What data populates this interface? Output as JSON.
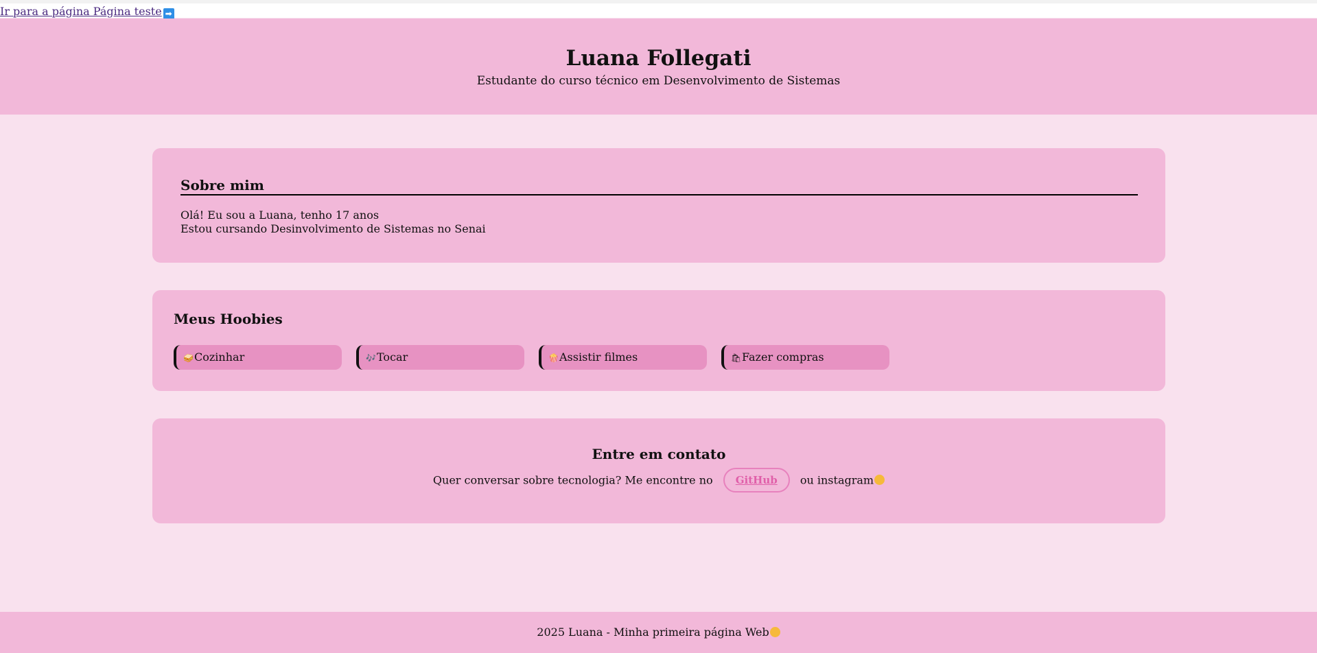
{
  "topbar": {
    "link_text": "Ir para a página Página teste",
    "link_icon": "arrow-right-icon"
  },
  "header": {
    "title": "Luana Follegati",
    "subtitle": "Estudante do curso técnico em Desenvolvimento de Sistemas"
  },
  "about": {
    "heading": "Sobre mim",
    "line1": "Olá! Eu sou a Luana, tenho 17 anos",
    "line2": "Estou cursando Desinvolvimento de Sistemas no Senai"
  },
  "hobbies": {
    "heading": "Meus Hoobies",
    "items": [
      {
        "emoji": "🥪",
        "label": "Cozinhar"
      },
      {
        "emoji": "🎶",
        "label": "Tocar"
      },
      {
        "emoji": "🍿",
        "label": "Assistir filmes"
      },
      {
        "emoji": "🛍",
        "label": "Fazer compras"
      }
    ]
  },
  "contact": {
    "heading": "Entre em contato",
    "text_before": "Quer conversar sobre tecnologia? Me encontre no",
    "github_label": "GitHub",
    "text_after": "ou instagram"
  },
  "footer": {
    "text": "2025 Luana - Minha primeira página Web"
  },
  "colors": {
    "background": "#f9e1ee",
    "card": "#f2b8d9",
    "hobby_pill": "#e792c2",
    "accent": "#e05fa9"
  }
}
